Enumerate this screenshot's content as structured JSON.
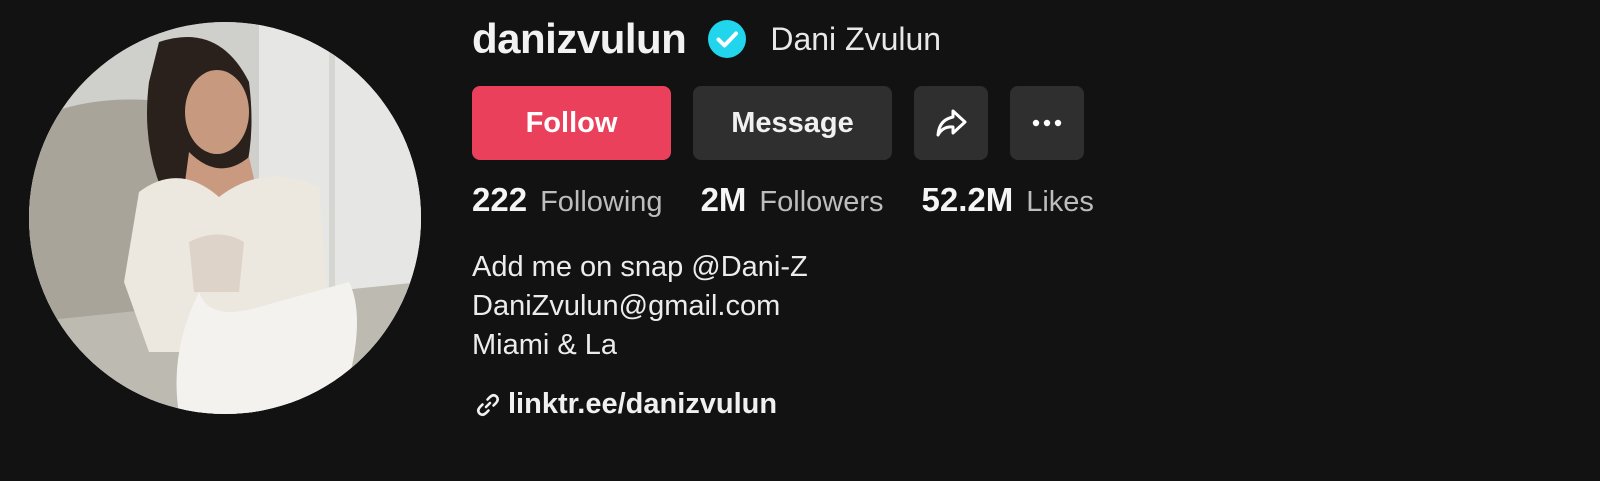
{
  "profile": {
    "username": "danizvulun",
    "display_name": "Dani Zvulun",
    "verified": true,
    "verified_color": "#20d5ec"
  },
  "actions": {
    "follow_label": "Follow",
    "message_label": "Message",
    "share_icon": "share-arrow-icon",
    "more_icon": "more-horizontal-icon",
    "follow_color": "#ea405c"
  },
  "stats": [
    {
      "value": "222",
      "label": "Following"
    },
    {
      "value": "2M",
      "label": "Followers"
    },
    {
      "value": "52.2M",
      "label": "Likes"
    }
  ],
  "bio": {
    "lines": [
      "Add me on snap @Dani-Z",
      "DaniZvulun@gmail.com",
      "Miami & La"
    ]
  },
  "link": {
    "icon": "link-icon",
    "text": "linktr.ee/danizvulun"
  }
}
